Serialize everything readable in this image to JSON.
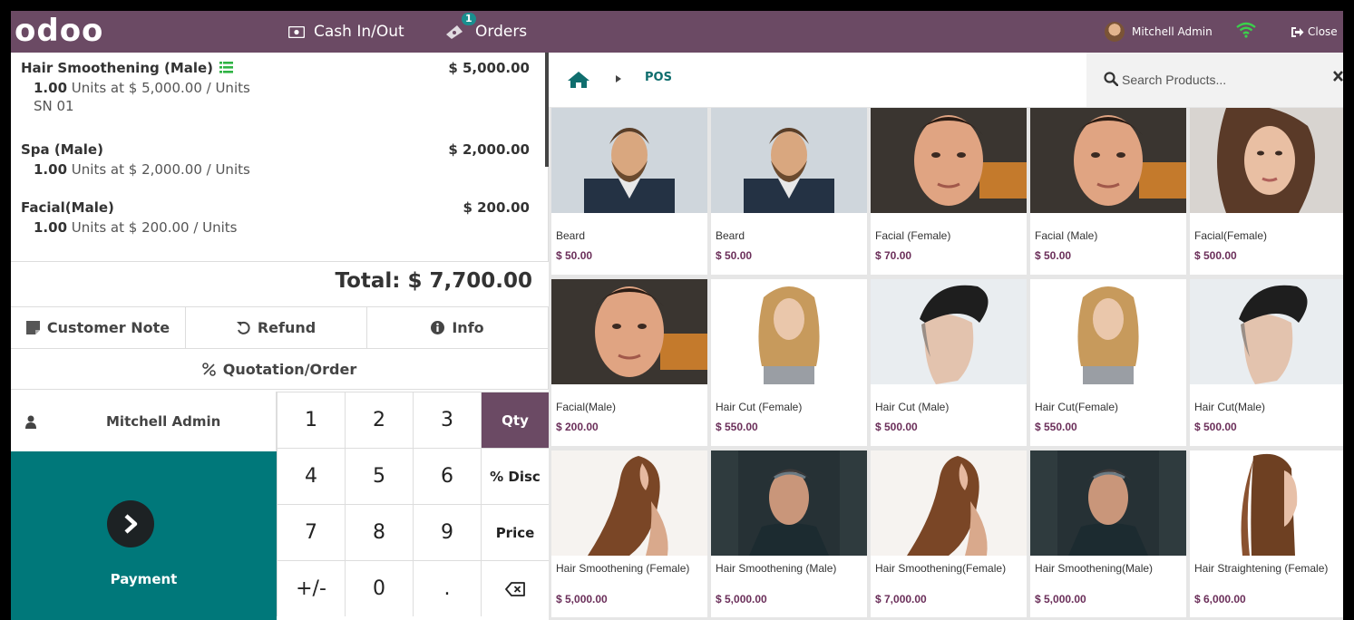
{
  "header": {
    "logo": "odoo",
    "cash_label": "Cash In/Out",
    "orders_label": "Orders",
    "orders_badge": "1",
    "user_name": "Mitchell Admin",
    "close_label": "Close",
    "bar_color": "#6b4a64"
  },
  "order": {
    "lines": [
      {
        "name": "Hair Smoothening (Male)",
        "qty": "1.00",
        "info": "Units at $ 5,000.00 / Units",
        "price": "$ 5,000.00",
        "sn": "SN 01"
      },
      {
        "name": "Spa (Male)",
        "qty": "1.00",
        "info": "Units at $ 2,000.00 / Units",
        "price": "$ 2,000.00"
      },
      {
        "name": "Facial(Male)",
        "qty": "1.00",
        "info": "Units at $ 200.00 / Units",
        "price": "$ 200.00"
      }
    ],
    "total": "Total: $ 7,700.00"
  },
  "controls": {
    "customer_note": "Customer Note",
    "refund": "Refund",
    "info": "Info",
    "quotation": "Quotation/Order",
    "customer": "Mitchell Admin",
    "payment": "Payment"
  },
  "numpad": {
    "k1": "1",
    "k2": "2",
    "k3": "3",
    "qty": "Qty",
    "k4": "4",
    "k5": "5",
    "k6": "6",
    "disc": "% Disc",
    "k7": "7",
    "k8": "8",
    "k9": "9",
    "price": "Price",
    "sign": "+/-",
    "k0": "0",
    "dot": "."
  },
  "breadcrumb": {
    "pos": "POS"
  },
  "search": {
    "placeholder": "Search Products..."
  },
  "products": [
    {
      "name": "Beard",
      "price": "$ 50.00",
      "image": "man-beard-suit"
    },
    {
      "name": "Beard",
      "price": "$ 50.00",
      "image": "man-beard-suit"
    },
    {
      "name": "Facial (Female)",
      "price": "$ 70.00",
      "image": "man-face-closeup"
    },
    {
      "name": "Facial (Male)",
      "price": "$ 50.00",
      "image": "man-face-closeup"
    },
    {
      "name": "Facial(Female)",
      "price": "$ 500.00",
      "image": "woman-face"
    },
    {
      "name": "Facial(Male)",
      "price": "$ 200.00",
      "image": "man-face-closeup"
    },
    {
      "name": "Hair Cut (Female)",
      "price": "$ 550.00",
      "image": "woman-wavy-hair"
    },
    {
      "name": "Hair Cut (Male)",
      "price": "$ 500.00",
      "image": "man-fade-haircut"
    },
    {
      "name": "Hair Cut(Female)",
      "price": "$ 550.00",
      "image": "woman-wavy-hair"
    },
    {
      "name": "Hair Cut(Male)",
      "price": "$ 500.00",
      "image": "man-fade-haircut"
    },
    {
      "name": "Hair Smoothening (Female)",
      "price": "$ 5,000.00",
      "image": "woman-long-hair"
    },
    {
      "name": "Hair Smoothening (Male)",
      "price": "$ 5,000.00",
      "image": "man-styled-hair"
    },
    {
      "name": "Hair Smoothening(Female)",
      "price": "$ 7,000.00",
      "image": "woman-long-hair"
    },
    {
      "name": "Hair Smoothening(Male)",
      "price": "$ 5,000.00",
      "image": "man-styled-hair"
    },
    {
      "name": "Hair Straightening (Female)",
      "price": "$ 6,000.00",
      "image": "woman-straight-hair"
    }
  ]
}
